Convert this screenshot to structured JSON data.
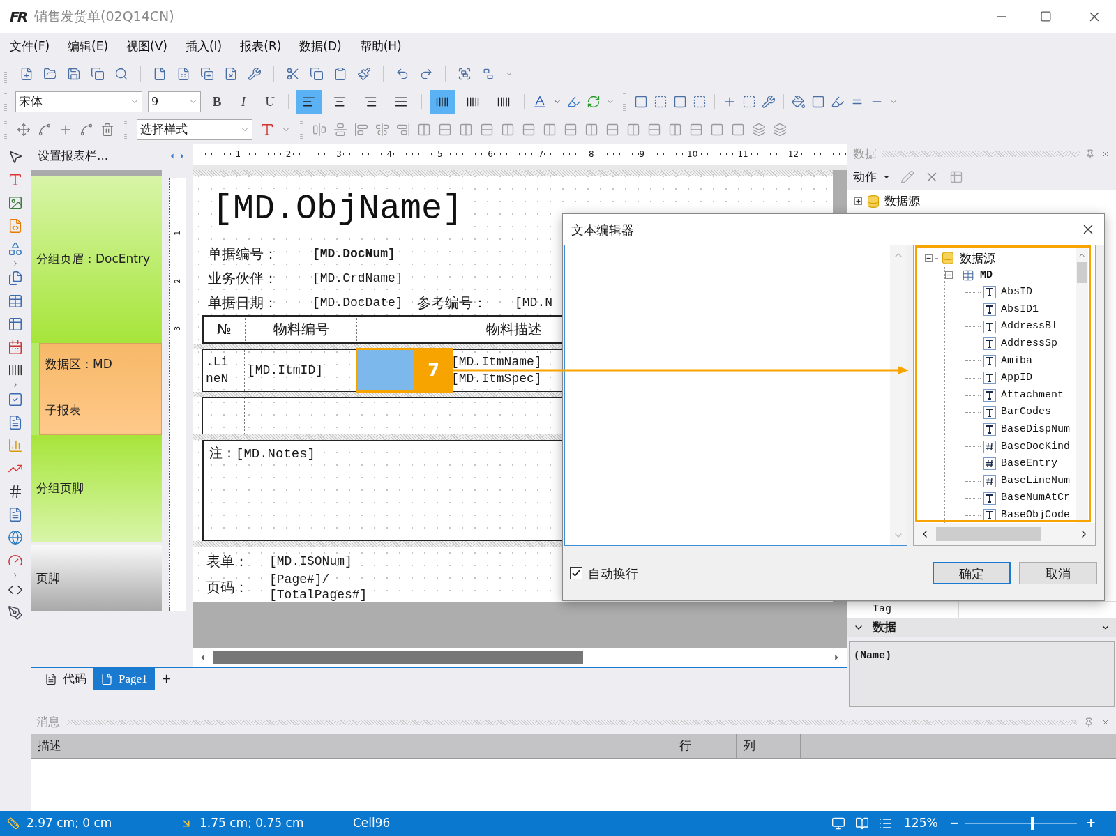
{
  "window": {
    "logo": "FR",
    "title": "销售发货单(02Q14CN)"
  },
  "menu": [
    "文件(F)",
    "编辑(E)",
    "视图(V)",
    "插入(I)",
    "报表(R)",
    "数据(D)",
    "帮助(H)"
  ],
  "format_toolbar": {
    "font": "宋体",
    "size": "9",
    "bold": "B",
    "italic": "I",
    "underline": "U",
    "text_align": [
      {
        "selected": true
      },
      {
        "selected": false
      },
      {
        "selected": false
      },
      {
        "selected": false
      }
    ],
    "vertical_align": [
      {
        "selected": true
      },
      {
        "selected": false
      },
      {
        "selected": false
      }
    ]
  },
  "layout_toolbar": {
    "style": "选择样式"
  },
  "bands_panel": {
    "title": "设置报表栏...",
    "bands": [
      {
        "kind": "group_header",
        "label": "分组页眉：DocEntry"
      },
      {
        "kind": "data",
        "label": "数据区：MD",
        "subreport": "子报表"
      },
      {
        "kind": "group_footer",
        "label": "分组页脚"
      },
      {
        "kind": "page_footer",
        "label": "页脚"
      }
    ]
  },
  "ruler": {
    "marks": [
      "1",
      "2",
      "3",
      "4",
      "5",
      "6",
      "7",
      "8",
      "9",
      "10",
      "11",
      "12"
    ]
  },
  "vertical_ruler": {
    "marks": [
      "1",
      "2",
      "3"
    ]
  },
  "report": {
    "title": "[MD.ObjName]",
    "fields": [
      {
        "label": "单据编号：",
        "value": "[MD.DocNum]",
        "bold": true
      },
      {
        "label": "业务伙伴：",
        "value": "[MD.CrdName]",
        "bold": false
      },
      {
        "label": "单据日期：",
        "value": "[MD.DocDate]",
        "bold": false,
        "extra_label": "参考编号：",
        "extra_value": "[MD.N"
      }
    ],
    "table": {
      "columns": [
        "№",
        "物料编号",
        "物料描述"
      ],
      "cells": [
        {
          "lines": [
            ".LineN"
          ],
          "selected": false
        },
        {
          "lines": [
            "[MD.ItmID]"
          ],
          "selected": false
        },
        {
          "selected": true
        },
        {
          "lines": [
            "[MD.ItmName]",
            "[MD.ItmSpec]"
          ],
          "selected": false
        }
      ]
    },
    "notes": "注：[MD.Notes]",
    "footer": [
      {
        "label": "表单：",
        "lines": [
          "[MD.ISONum]"
        ]
      },
      {
        "label": "页码：",
        "lines": [
          "[Page#]/",
          "[TotalPages#]"
        ]
      }
    ]
  },
  "annotation": {
    "label": "7"
  },
  "page_tabs": [
    {
      "label": "代码",
      "selected": false
    },
    {
      "label": "Page1",
      "selected": true
    }
  ],
  "add_tab": "+",
  "data_panel": {
    "title": "数据",
    "action": "动作",
    "tree": [
      {
        "label": "数据源",
        "expanded": false
      }
    ],
    "property_rows": [
      "Tag"
    ],
    "category": {
      "label": "数据",
      "expanded": true
    },
    "description": "(Name)"
  },
  "dialog": {
    "title": "文本编辑器",
    "tree": [
      {
        "kind": "datasource",
        "label": "数据源",
        "expanded": true,
        "children": [
          {
            "kind": "table",
            "label": "MD",
            "expanded": true,
            "children": [
              {
                "kind": "text",
                "label": "AbsID"
              },
              {
                "kind": "text",
                "label": "AbsID1"
              },
              {
                "kind": "text",
                "label": "AddressBl"
              },
              {
                "kind": "text",
                "label": "AddressSp"
              },
              {
                "kind": "text",
                "label": "Amiba"
              },
              {
                "kind": "text",
                "label": "AppID"
              },
              {
                "kind": "text",
                "label": "Attachment"
              },
              {
                "kind": "text",
                "label": "BarCodes"
              },
              {
                "kind": "text",
                "label": "BaseDispNum"
              },
              {
                "kind": "number",
                "label": "BaseDocKind"
              },
              {
                "kind": "number",
                "label": "BaseEntry"
              },
              {
                "kind": "number",
                "label": "BaseLineNum"
              },
              {
                "kind": "text",
                "label": "BaseNumAtCr"
              },
              {
                "kind": "text",
                "label": "BaseObjCode"
              }
            ]
          }
        ]
      }
    ],
    "word_wrap": {
      "label": "自动换行",
      "checked": true
    },
    "buttons": [
      {
        "label": "确定",
        "default": true
      },
      {
        "label": "取消",
        "default": false
      }
    ]
  },
  "messages": {
    "title": "消息",
    "columns": [
      "描述",
      "行",
      "列"
    ]
  },
  "status_bar": {
    "position": "2.97 cm; 0 cm",
    "size": "1.75 cm; 0.75 cm",
    "object": "Cell96",
    "zoom": "125%",
    "zoom_out": "−",
    "zoom_in": "+",
    "zoom_slider": {
      "level": 0.6
    }
  }
}
